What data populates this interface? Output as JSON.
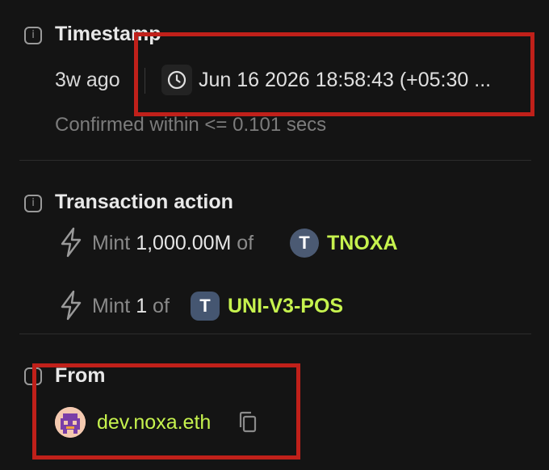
{
  "timestamp": {
    "title": "Timestamp",
    "age": "3w ago",
    "value": "Jun 16 2026 18:58:43 (+05:30 ...",
    "confirmed": "Confirmed within <= 0.101 secs"
  },
  "transaction_action": {
    "title": "Transaction action",
    "actions": [
      {
        "verb": "Mint",
        "amount": "1,000.00M",
        "of": "of",
        "token_letter": "T",
        "token": "TNOXA"
      },
      {
        "verb": "Mint",
        "amount": "1",
        "of": "of",
        "token_letter": "T",
        "token": "UNI-V3-POS"
      }
    ]
  },
  "from": {
    "title": "From",
    "name": "dev.noxa.eth"
  },
  "icons": {
    "info": "info-icon",
    "clock": "clock-icon",
    "bolt": "lightning-icon",
    "copy": "copy-icon"
  },
  "colors": {
    "background": "#141414",
    "accent": "#c6f24e",
    "annotation": "#c0201a",
    "token_avatar": "#4b5a73"
  }
}
